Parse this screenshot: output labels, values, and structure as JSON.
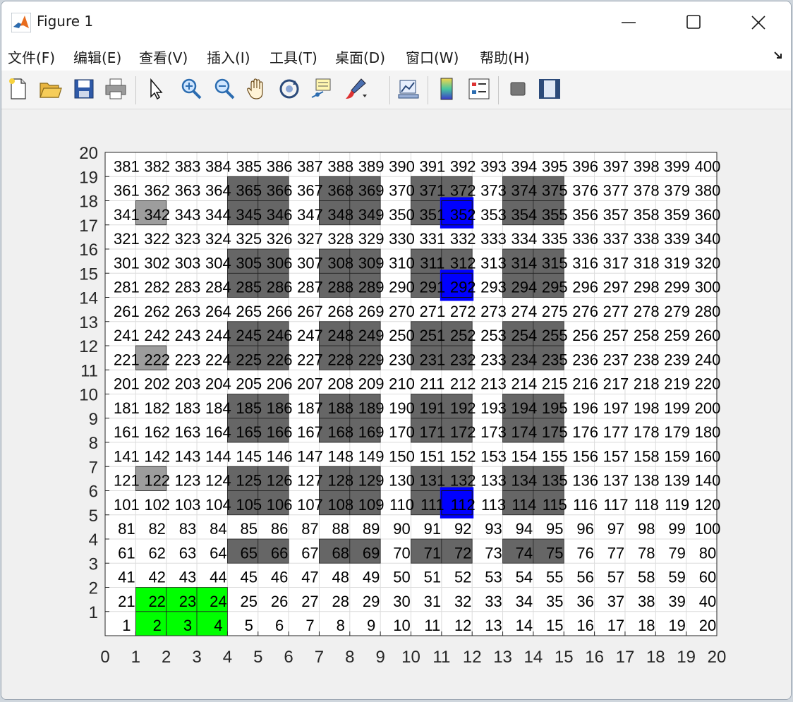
{
  "window": {
    "title": "Figure 1"
  },
  "menu": {
    "items": [
      {
        "label": "文件(F)"
      },
      {
        "label": "编辑(E)"
      },
      {
        "label": "查看(V)"
      },
      {
        "label": "插入(I)"
      },
      {
        "label": "工具(T)"
      },
      {
        "label": "桌面(D)"
      },
      {
        "label": "窗口(W)"
      },
      {
        "label": "帮助(H)"
      }
    ]
  },
  "toolbar": {
    "buttons": [
      "new-figure-icon",
      "open-file-icon",
      "save-icon",
      "print-icon",
      "pointer-icon",
      "zoom-in-icon",
      "zoom-out-icon",
      "pan-hand-icon",
      "rotate-3d-icon",
      "data-cursor-icon",
      "brush-icon",
      "link-plot-icon",
      "colorbar-icon",
      "legend-icon",
      "hide-plot-tools-icon",
      "show-plot-tools-icon"
    ]
  },
  "chart_data": {
    "type": "heatmap",
    "title": "",
    "xlabel": "",
    "ylabel": "",
    "xlim": [
      0,
      20
    ],
    "ylim": [
      0,
      20
    ],
    "grid": true,
    "xticks": [
      0,
      1,
      2,
      3,
      4,
      5,
      6,
      7,
      8,
      9,
      10,
      11,
      12,
      13,
      14,
      15,
      16,
      17,
      18,
      19,
      20
    ],
    "yticks": [
      1,
      2,
      3,
      4,
      5,
      6,
      7,
      8,
      9,
      10,
      11,
      12,
      13,
      14,
      15,
      16,
      17,
      18,
      19,
      20
    ],
    "cell_numbering": "cells numbered 1..400, left to right, bottom to top",
    "colors": {
      "free": "#ffffff",
      "obstacle": "#666666",
      "light_obstacle": "#9d9d9d",
      "start": "#00ff00",
      "target": "#0000ff",
      "grid": "#dcdcdc"
    },
    "start_cells": [
      2,
      3,
      4,
      22,
      23,
      24
    ],
    "target_cells": [
      112,
      292,
      352
    ],
    "light_obstacle_cells": [
      122,
      222,
      342
    ],
    "obstacle_cells": [
      65,
      66,
      68,
      69,
      71,
      72,
      74,
      75,
      105,
      106,
      108,
      109,
      111,
      114,
      115,
      125,
      126,
      128,
      129,
      131,
      132,
      134,
      135,
      165,
      166,
      168,
      169,
      171,
      172,
      174,
      175,
      185,
      186,
      188,
      189,
      191,
      192,
      194,
      195,
      225,
      226,
      228,
      229,
      231,
      232,
      234,
      235,
      245,
      246,
      248,
      249,
      251,
      252,
      254,
      255,
      285,
      286,
      288,
      289,
      291,
      294,
      295,
      305,
      306,
      308,
      309,
      311,
      312,
      314,
      315,
      345,
      346,
      348,
      349,
      351,
      354,
      355,
      365,
      366,
      368,
      369,
      371,
      372,
      374,
      375
    ],
    "cell_labels_from": 1,
    "cell_labels_to": 400
  }
}
